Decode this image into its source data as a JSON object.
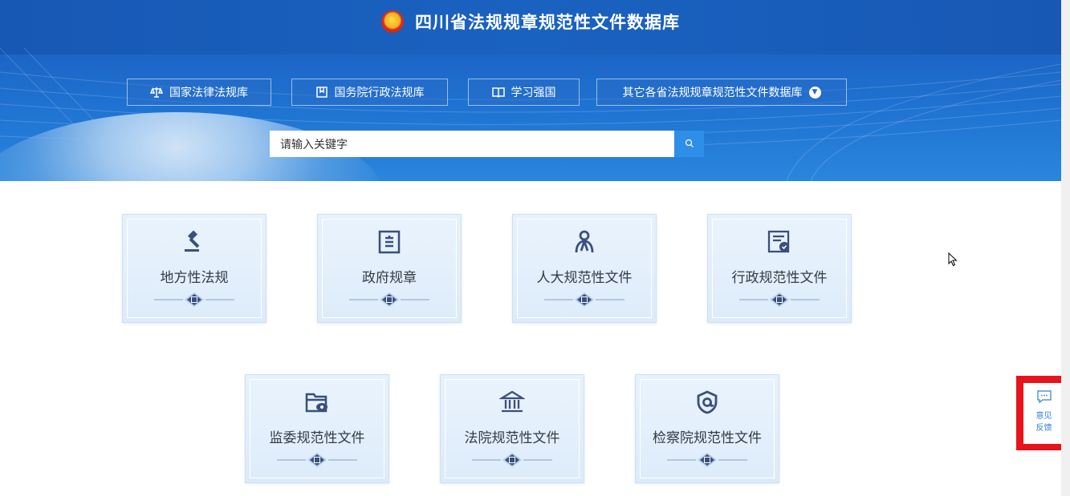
{
  "header": {
    "title": "四川省法规规章规范性文件数据库",
    "emblem_icon": "national-emblem-icon"
  },
  "nav": {
    "items": [
      {
        "label": "国家法律法规库",
        "icon": "scales-icon"
      },
      {
        "label": "国务院行政法规库",
        "icon": "bookmark-icon"
      },
      {
        "label": "学习强国",
        "icon": "open-book-icon"
      },
      {
        "label": "其它各省法规规章规范性文件数据库",
        "icon": "chevron-down-icon"
      }
    ]
  },
  "search": {
    "placeholder": "请输入关键字",
    "button_icon": "search-icon"
  },
  "categories": [
    {
      "label": "地方性法规",
      "icon": "gavel-icon"
    },
    {
      "label": "政府规章",
      "icon": "document-icon"
    },
    {
      "label": "人大规范性文件",
      "icon": "people-icon"
    },
    {
      "label": "行政规范性文件",
      "icon": "form-check-icon"
    },
    {
      "label": "监委规范性文件",
      "icon": "folder-eye-icon"
    },
    {
      "label": "法院规范性文件",
      "icon": "courthouse-icon"
    },
    {
      "label": "检察院规范性文件",
      "icon": "shield-target-icon"
    }
  ],
  "feedback": {
    "line1": "意见",
    "line2": "反馈",
    "icon": "chat-bubble-icon"
  },
  "colors": {
    "header_blue": "#1c65c6",
    "icon_navy": "#3a4f7e",
    "accent_blue": "#2e8ee8",
    "feedback_red": "#e8131b"
  }
}
